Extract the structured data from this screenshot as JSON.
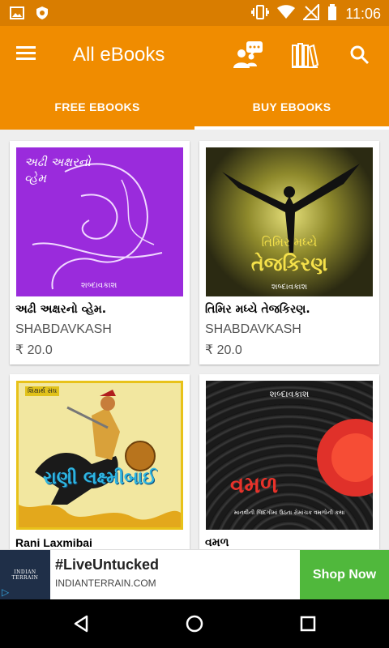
{
  "status_bar": {
    "time": "11:06",
    "icons": [
      "image-icon",
      "shield-icon",
      "vibrate-icon",
      "wifi-icon",
      "no-signal-icon",
      "battery-icon"
    ]
  },
  "app_bar": {
    "title": "All eBooks",
    "icons": [
      "menu-icon",
      "chat-users-icon",
      "library-icon",
      "search-icon"
    ]
  },
  "tabs": [
    {
      "label": "FREE EBOOKS",
      "active": false
    },
    {
      "label": "BUY EBOOKS",
      "active": true
    }
  ],
  "books": [
    {
      "title": "અઢી અક્ષરનો વ્હેમ.",
      "publisher": "SHABDAVKASH",
      "price": "₹ 20.0",
      "cover_text_top": "અઢી અક્ષરનો વ્હેમ",
      "cover_text_bottom": "શબ્દાવકાશ",
      "cover_color": "#9a2bdc"
    },
    {
      "title": "તિમિર મધ્યે તેજકિરણ.",
      "publisher": "SHABDAVKASH",
      "price": "₹ 20.0",
      "cover_text_top": "તિમિર મધ્યે",
      "cover_text_main": "તેજકિરણ",
      "cover_text_bottom": "શબ્દાવકાશ",
      "cover_color": "#2b2a12"
    },
    {
      "title": "Rani Laxmibai",
      "publisher": "",
      "price": "",
      "cover_text_top": "શિક્ષાર્થ સંઘ",
      "cover_text_main": "રાણી લક્ષ્મીબાઈ",
      "cover_color": "#f2e7a0"
    },
    {
      "title": "વમળ",
      "publisher": "",
      "price": "",
      "cover_text_top": "શબ્દાવકાશ",
      "cover_text_main": "વમળ",
      "cover_text_bottom": "માનવીની જિંદગીમાં ઉઠતા રોમાંચક વમળોની કથા",
      "cover_color": "#111111"
    }
  ],
  "ad": {
    "brand": "INDIAN TERRAIN",
    "headline": "#LiveUntucked",
    "domain": "INDIANTERRAIN.COM",
    "cta": "Shop Now"
  },
  "nav_bar": {
    "icons": [
      "back-icon",
      "home-icon",
      "recents-icon"
    ]
  }
}
